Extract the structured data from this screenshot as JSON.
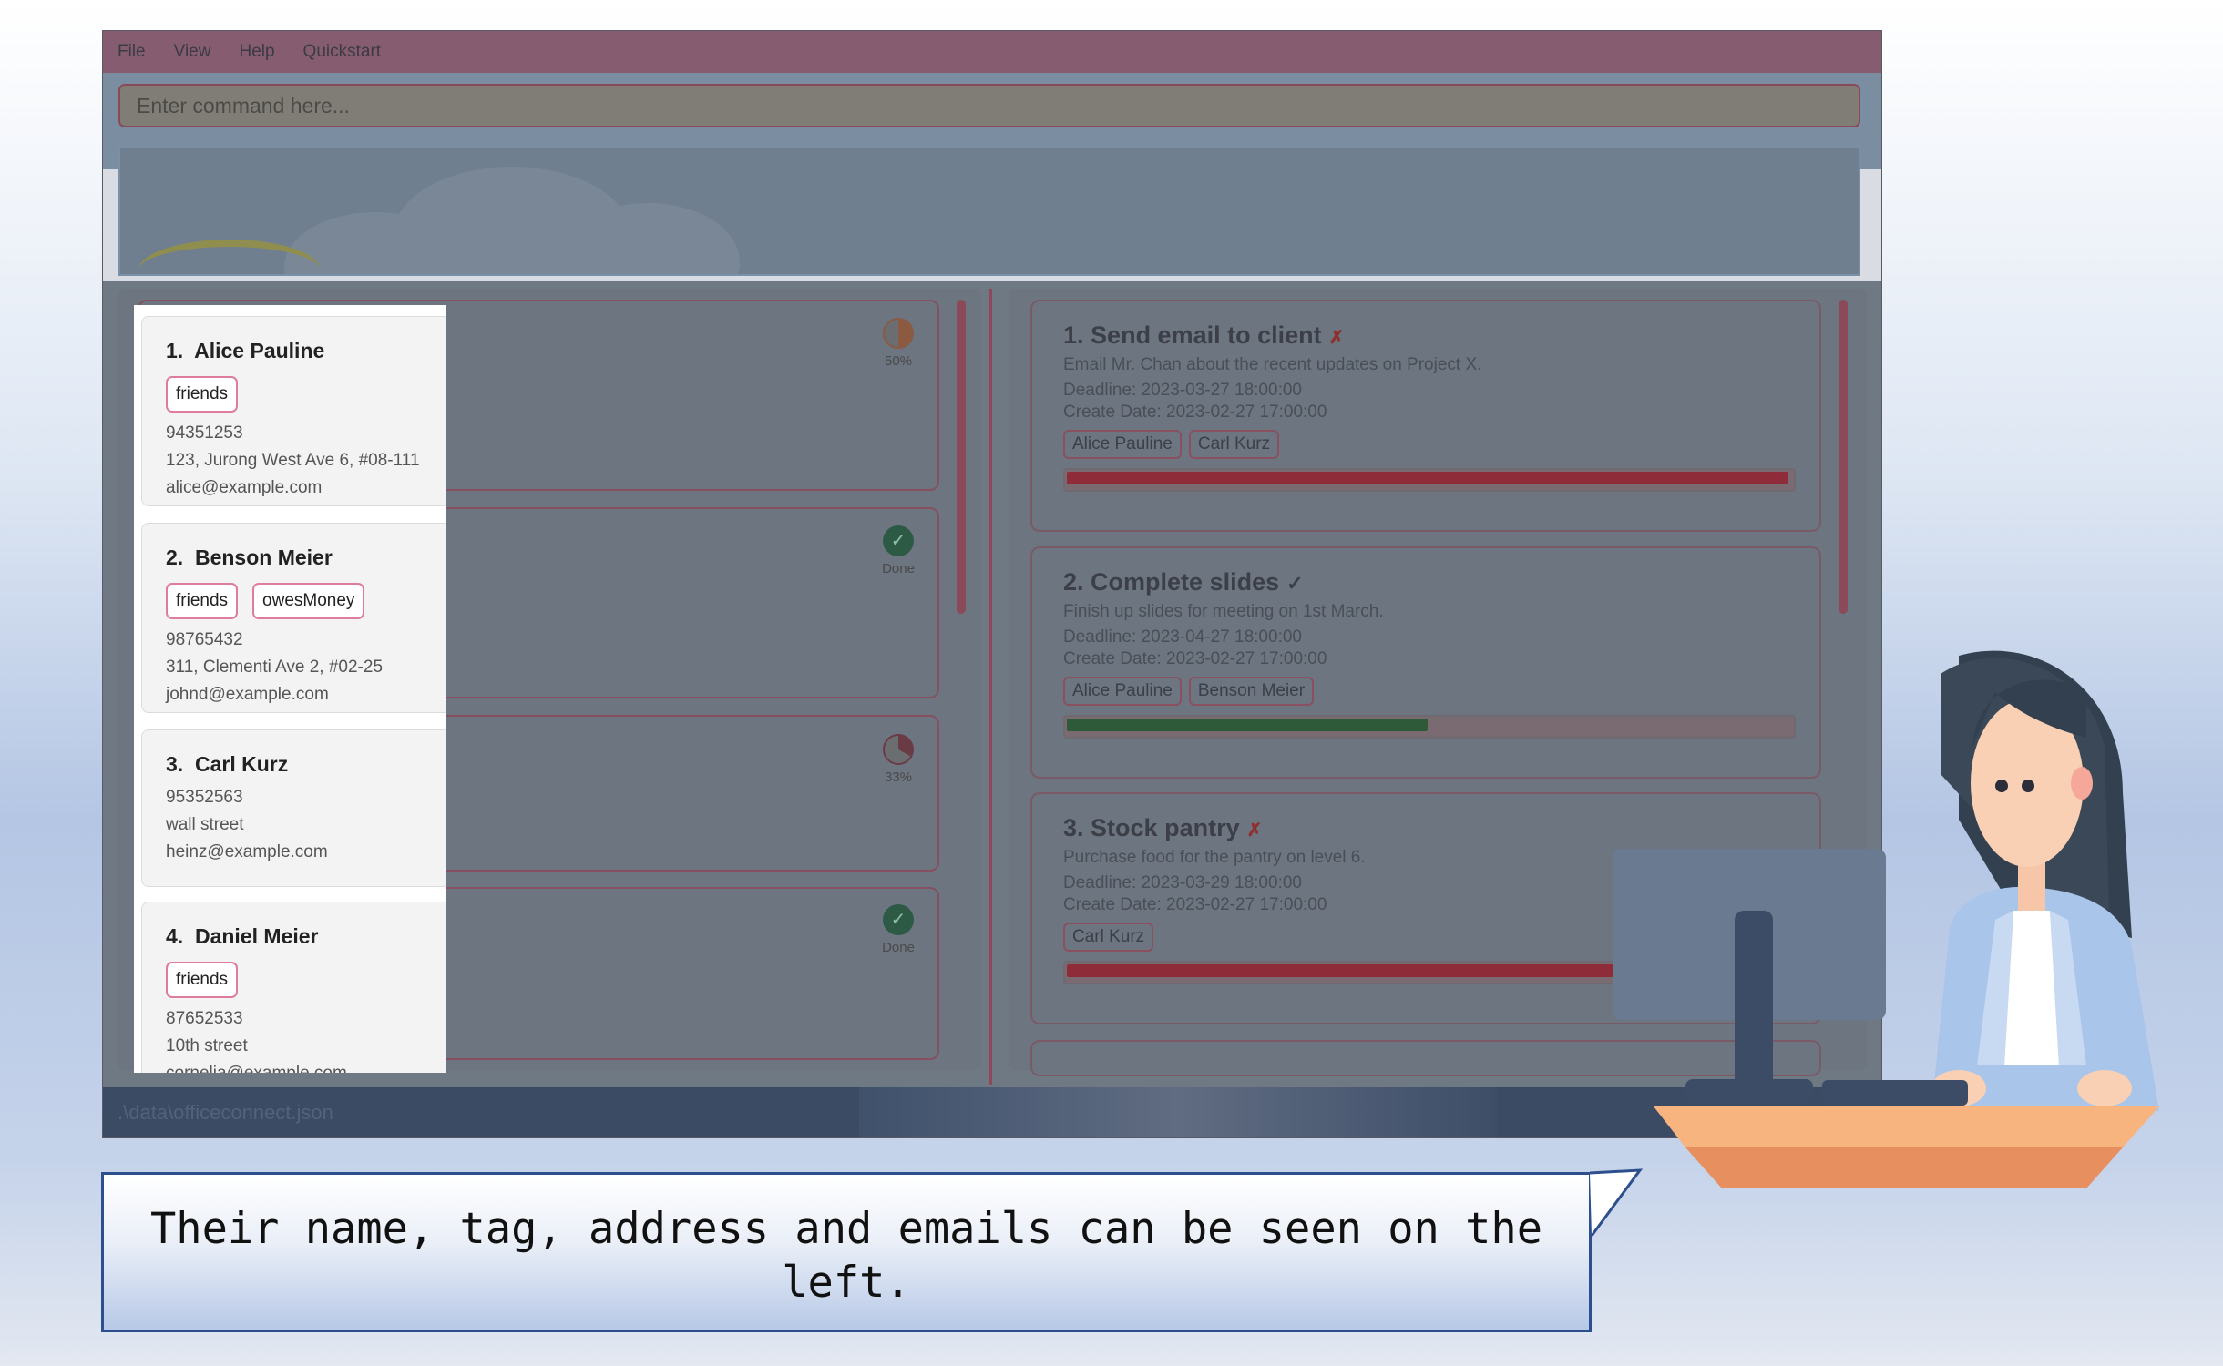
{
  "menu": {
    "items": [
      "File",
      "View",
      "Help",
      "Quickstart"
    ]
  },
  "command": {
    "placeholder": "Enter command here..."
  },
  "persons": [
    {
      "index": "1.",
      "name": "Alice Pauline",
      "tags": [
        "friends"
      ],
      "phone": "94351253",
      "address": "123, Jurong West Ave 6, #08-111",
      "email": "alice@example.com",
      "progress_label": "50%"
    },
    {
      "index": "2.",
      "name": "Benson Meier",
      "tags": [
        "friends",
        "owesMoney"
      ],
      "phone": "98765432",
      "address": "311, Clementi Ave 2, #02-25",
      "email": "johnd@example.com",
      "progress_label": "Done"
    },
    {
      "index": "3.",
      "name": "Carl Kurz",
      "tags": [],
      "phone": "95352563",
      "address": "wall street",
      "email": "heinz@example.com",
      "progress_label": "33%"
    },
    {
      "index": "4.",
      "name": "Daniel Meier",
      "tags": [
        "friends"
      ],
      "phone": "87652533",
      "address": "10th street",
      "email": "cornelia@example.com",
      "progress_label": "Done"
    }
  ],
  "tasks": [
    {
      "index": "1.",
      "title": "Send email to client",
      "mark": "✗",
      "description": "Email Mr. Chan about the recent updates on Project X.",
      "deadline": "Deadline: 2023-03-27 18:00:00",
      "created": "Create Date: 2023-02-27 17:00:00",
      "assignees": [
        "Alice Pauline",
        "Carl Kurz"
      ],
      "progress": 1.0,
      "bar_color": "#8e2c3a"
    },
    {
      "index": "2.",
      "title": "Complete slides",
      "mark": "✓",
      "description": "Finish up slides for meeting on 1st March.",
      "deadline": "Deadline: 2023-04-27 18:00:00",
      "created": "Create Date: 2023-02-27 17:00:00",
      "assignees": [
        "Alice Pauline",
        "Benson Meier"
      ],
      "progress": 0.5,
      "bar_color": "#2f5a3a"
    },
    {
      "index": "3.",
      "title": "Stock pantry",
      "mark": "✗",
      "description": "Purchase food for the pantry on level 6.",
      "deadline": "Deadline: 2023-03-29 18:00:00",
      "created": "Create Date: 2023-02-27 17:00:00",
      "assignees": [
        "Carl Kurz"
      ],
      "progress": 1.0,
      "bar_color": "#8e2c3a"
    }
  ],
  "statusbar": {
    "path": ".\\data\\officeconnect.json"
  },
  "caption": {
    "text": "Their name, tag, address and emails can be seen on the left."
  }
}
